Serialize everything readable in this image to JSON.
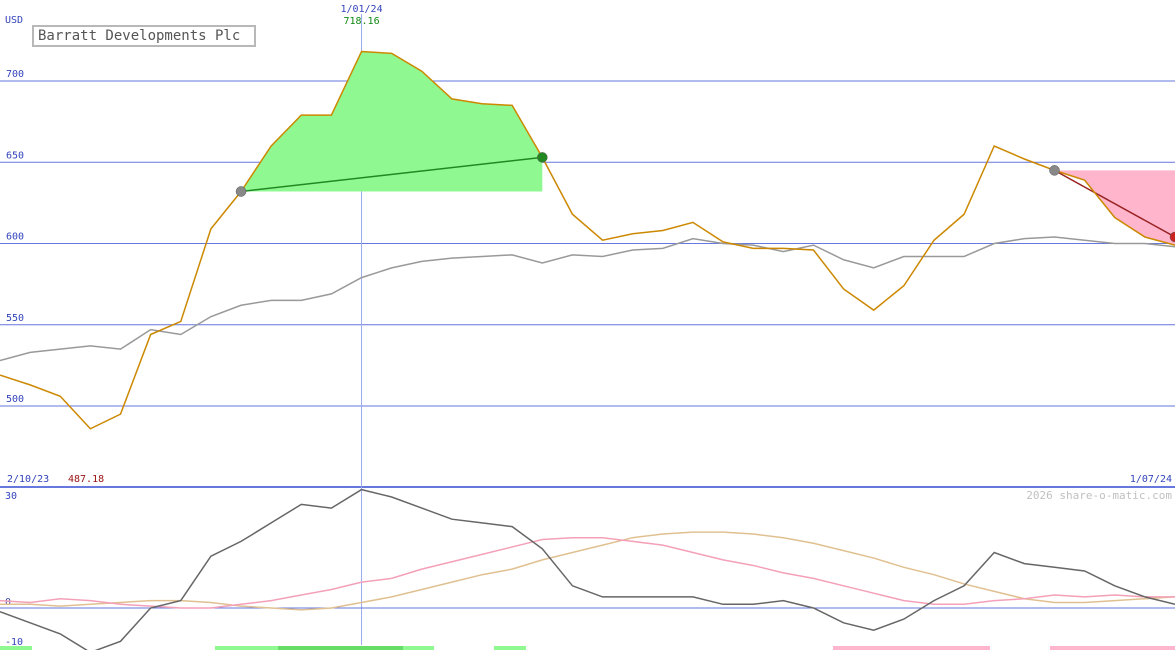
{
  "title": "Barratt Developments Plc",
  "currency": "USD",
  "credit": "2026 share-o-matic.com",
  "start_date": "2/10/23",
  "end_date": "1/07/24",
  "high_date": "1/01/24",
  "high_value": "718.16",
  "low_value": "487.18",
  "colors": {
    "price": "#cc8800",
    "average": "#999999",
    "gain": "#90f890",
    "loss": "#ffb6cc",
    "grid": "#6677dd",
    "osc_dark": "#666666",
    "osc_pink": "#f4a0b8",
    "osc_tan": "#e0c090"
  },
  "chart_data": [
    {
      "type": "line",
      "title": "Barratt Developments Plc",
      "ylabel": "USD",
      "y_ticks": [
        500,
        550,
        600,
        650,
        700
      ],
      "ylim": [
        450,
        735
      ],
      "x_points": 40,
      "grid": true,
      "series": [
        {
          "values": [
            519,
            513,
            506,
            486,
            495,
            544,
            552,
            609,
            632,
            660,
            679,
            679,
            718.16,
            717,
            706,
            689,
            686,
            685,
            653,
            618,
            602,
            606,
            608,
            613,
            601,
            597,
            597,
            596,
            572,
            559,
            574,
            602,
            618,
            660,
            652,
            645,
            639,
            616,
            604,
            599
          ]
        },
        {
          "values": [
            528,
            533,
            535,
            537,
            535,
            547,
            544,
            555,
            562,
            565,
            565,
            569,
            579,
            585,
            589,
            591,
            592,
            593,
            588,
            593,
            592,
            596,
            597,
            603,
            600,
            599,
            595,
            599,
            590,
            585,
            592,
            592,
            592,
            600,
            603,
            604,
            602,
            600,
            600,
            598
          ]
        }
      ],
      "markers": [
        {
          "index": 8,
          "value": 632,
          "kind": "buy"
        },
        {
          "index": 18,
          "value": 653,
          "kind": "sell"
        },
        {
          "index": 35,
          "value": 645,
          "kind": "buy"
        },
        {
          "index": 39,
          "value": 604,
          "kind": "sell"
        }
      ]
    },
    {
      "type": "line",
      "y_ticks": [
        30,
        0,
        -10
      ],
      "ylim": [
        -12,
        30
      ],
      "series": [
        {
          "values": [
            -1,
            -4,
            -7,
            -12,
            -9,
            0,
            2,
            14,
            18,
            23,
            28,
            27,
            32,
            30,
            27,
            24,
            23,
            22,
            16,
            6,
            3,
            3,
            3,
            3,
            1,
            1,
            2,
            0,
            -4,
            -6,
            -3,
            2,
            6,
            15,
            12,
            11,
            10,
            6,
            3,
            1
          ]
        },
        {
          "values": [
            2,
            1.5,
            2.5,
            2,
            1,
            0.5,
            0,
            0,
            1,
            2,
            3.5,
            5,
            7,
            8,
            10.5,
            12.5,
            14.5,
            16.5,
            18.5,
            19,
            19,
            18,
            17,
            15,
            13,
            11.5,
            9.5,
            8,
            6,
            4,
            2,
            1,
            1,
            2,
            2.5,
            3.5,
            3,
            3.5,
            3,
            3
          ]
        },
        {
          "values": [
            1,
            1,
            0.5,
            1,
            1.5,
            2,
            2,
            1.5,
            0.5,
            0,
            -0.5,
            0,
            1.5,
            3,
            5,
            7,
            9,
            10.5,
            13,
            15,
            17,
            19,
            20,
            20.5,
            20.5,
            20,
            19,
            17.5,
            15.5,
            13.5,
            11,
            9,
            6.5,
            4.5,
            2.5,
            1.5,
            1.5,
            2,
            2.5,
            3
          ]
        }
      ]
    }
  ]
}
